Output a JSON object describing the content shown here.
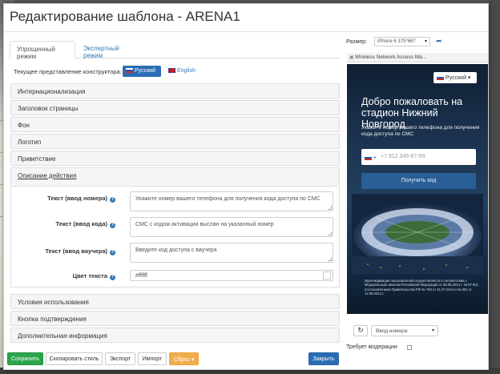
{
  "dialog": {
    "title": "Редактирование шаблона - ARENA1"
  },
  "tabs": [
    {
      "label": "Упрощенный режим"
    },
    {
      "label": "Экспертный режим"
    }
  ],
  "language": {
    "label": "Текущее представление конструктора:",
    "russian": "Русский",
    "english": "English"
  },
  "panels": [
    {
      "label": "Интернационализация"
    },
    {
      "label": "Заголовок страницы"
    },
    {
      "label": "Фон"
    },
    {
      "label": "Логотип"
    },
    {
      "label": "Приветствие"
    },
    {
      "label": "Описание действия"
    },
    {
      "label": "Условия использования"
    },
    {
      "label": "Кнопка подтверждения"
    },
    {
      "label": "Дополнительная информация"
    }
  ],
  "form": {
    "phone_text_label": "Текст (ввод номера)",
    "phone_text_value": "Укажите номер вашего телефона для получения кода доступа по СМС",
    "code_text_label": "Текст (ввод кода)",
    "code_text_value": "СМС с кодом активации выслан на указанный номер",
    "voucher_text_label": "Текст (ввод ваучера)",
    "voucher_text_value": "Введите код доступа с ваучера",
    "color_label": "Цвет текста",
    "color_value": "#ffffff"
  },
  "buttons": {
    "save": "Сохранить",
    "copy_style": "Скопировать стиль",
    "export": "Экспорт",
    "import": "Импорт",
    "reset": "Сброс",
    "close": "Закрыть"
  },
  "preview": {
    "size_label": "Размер:",
    "size_value": "iPhone 6 375*667",
    "tab_title": "Wireless Network Access Ma...",
    "lang_selector": "Русский",
    "welcome_title": "Добро пожаловать на стадион Нижний Новгород",
    "hint": "Укажите номер вашего телефона для получения кода доступа по СМС",
    "phone_placeholder": "+7 912 345-67-89",
    "get_code": "Получить код",
    "legal": "Идентификация пользователей осуществляется в соответствии с Федеральным законом Российской Федерации от 05.05.2014 г. № 97-ФЗ, постановлением Правительства РФ № 758 от 31.07.2014 и № 801 от 12.08.2014 г.",
    "mode_select": "Ввод номера",
    "moderation_label": "Требует модерации"
  },
  "colors": {
    "accent": "#337ab7",
    "save": "#2ba64a",
    "reset": "#f0ad4e",
    "close": "#2a6db5"
  }
}
